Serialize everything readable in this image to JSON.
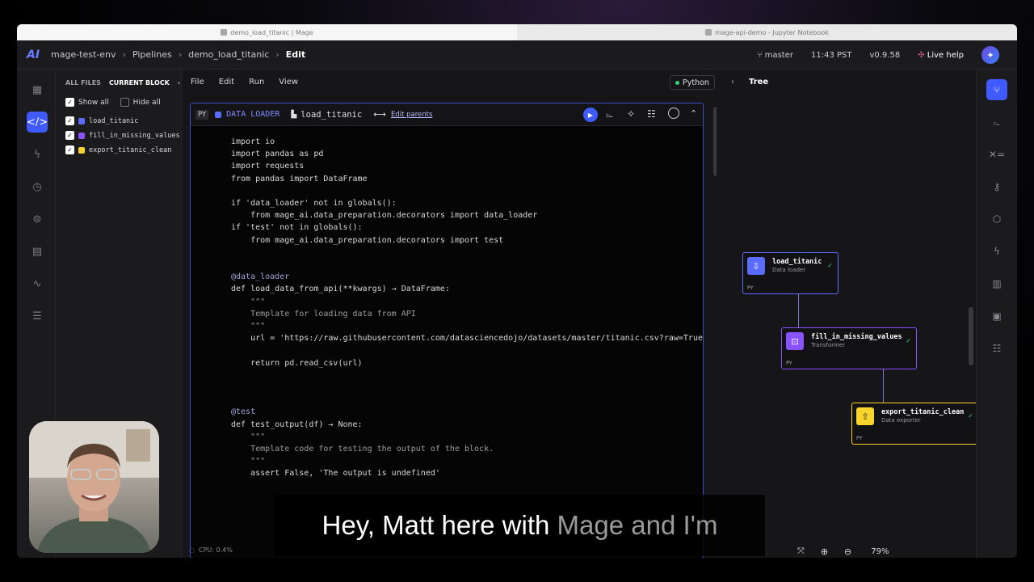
{
  "browser": {
    "tabs": [
      {
        "label": "demo_load_titanic | Mage",
        "active": true
      },
      {
        "label": "mage-api-demo - Jupyter Notebook",
        "active": false
      }
    ]
  },
  "header": {
    "logo": "AI",
    "breadcrumb": [
      "mage-test-env",
      "Pipelines",
      "demo_load_titanic",
      "Edit"
    ],
    "branch": "master",
    "time": "11:43 PST",
    "version": "v0.9.58",
    "live_help": "Live help"
  },
  "file_panel": {
    "tabs": [
      "ALL FILES",
      "CURRENT BLOCK"
    ],
    "show_all": "Show all",
    "hide_all": "Hide all",
    "blocks": [
      {
        "name": "load_titanic",
        "color": "#5a6cff"
      },
      {
        "name": "fill_in_missing_values",
        "color": "#8a52ff"
      },
      {
        "name": "export_titanic_clean",
        "color": "#f7d32b"
      }
    ]
  },
  "menu": [
    "File",
    "Edit",
    "Run",
    "View"
  ],
  "kernel": "Python",
  "block": {
    "lang": "PY",
    "type": "DATA LOADER",
    "name": "load_titanic",
    "edit_parents": "Edit parents",
    "code": [
      "import io",
      "import pandas as pd",
      "import requests",
      "from pandas import DataFrame",
      "",
      "if 'data_loader' not in globals():",
      "    from mage_ai.data_preparation.decorators import data_loader",
      "if 'test' not in globals():",
      "    from mage_ai.data_preparation.decorators import test",
      "",
      "",
      "@data_loader",
      "def load_data_from_api(**kwargs) → DataFrame:",
      "    \"\"\"",
      "    Template for loading data from API",
      "    \"\"\"",
      "    url = 'https://raw.githubusercontent.com/datasciencedojo/datasets/master/titanic.csv?raw=True'",
      "",
      "    return pd.read_csv(url)",
      "",
      "",
      "",
      "@test",
      "def test_output(df) → None:",
      "    \"\"\"",
      "    Template code for testing the output of the block.",
      "    \"\"\"",
      "    assert False, 'The output is undefined'"
    ]
  },
  "tree": {
    "title": "Tree",
    "nodes": [
      {
        "name": "load_titanic",
        "type": "Data loader",
        "lang": "PY",
        "color": "#5a6cff"
      },
      {
        "name": "fill_in_missing_values",
        "type": "Transformer",
        "lang": "PY",
        "color": "#8a52ff"
      },
      {
        "name": "export_titanic_clean",
        "type": "Data exporter",
        "lang": "PY",
        "color": "#f7d32b"
      }
    ],
    "zoom": "79%"
  },
  "status": {
    "cpu": "CPU: 0.4%"
  },
  "caption": {
    "main": "Hey, Matt here with",
    "dim": "Mage and I'm"
  },
  "colors": {
    "accent": "#3f5bff",
    "success": "#2fd47a"
  }
}
